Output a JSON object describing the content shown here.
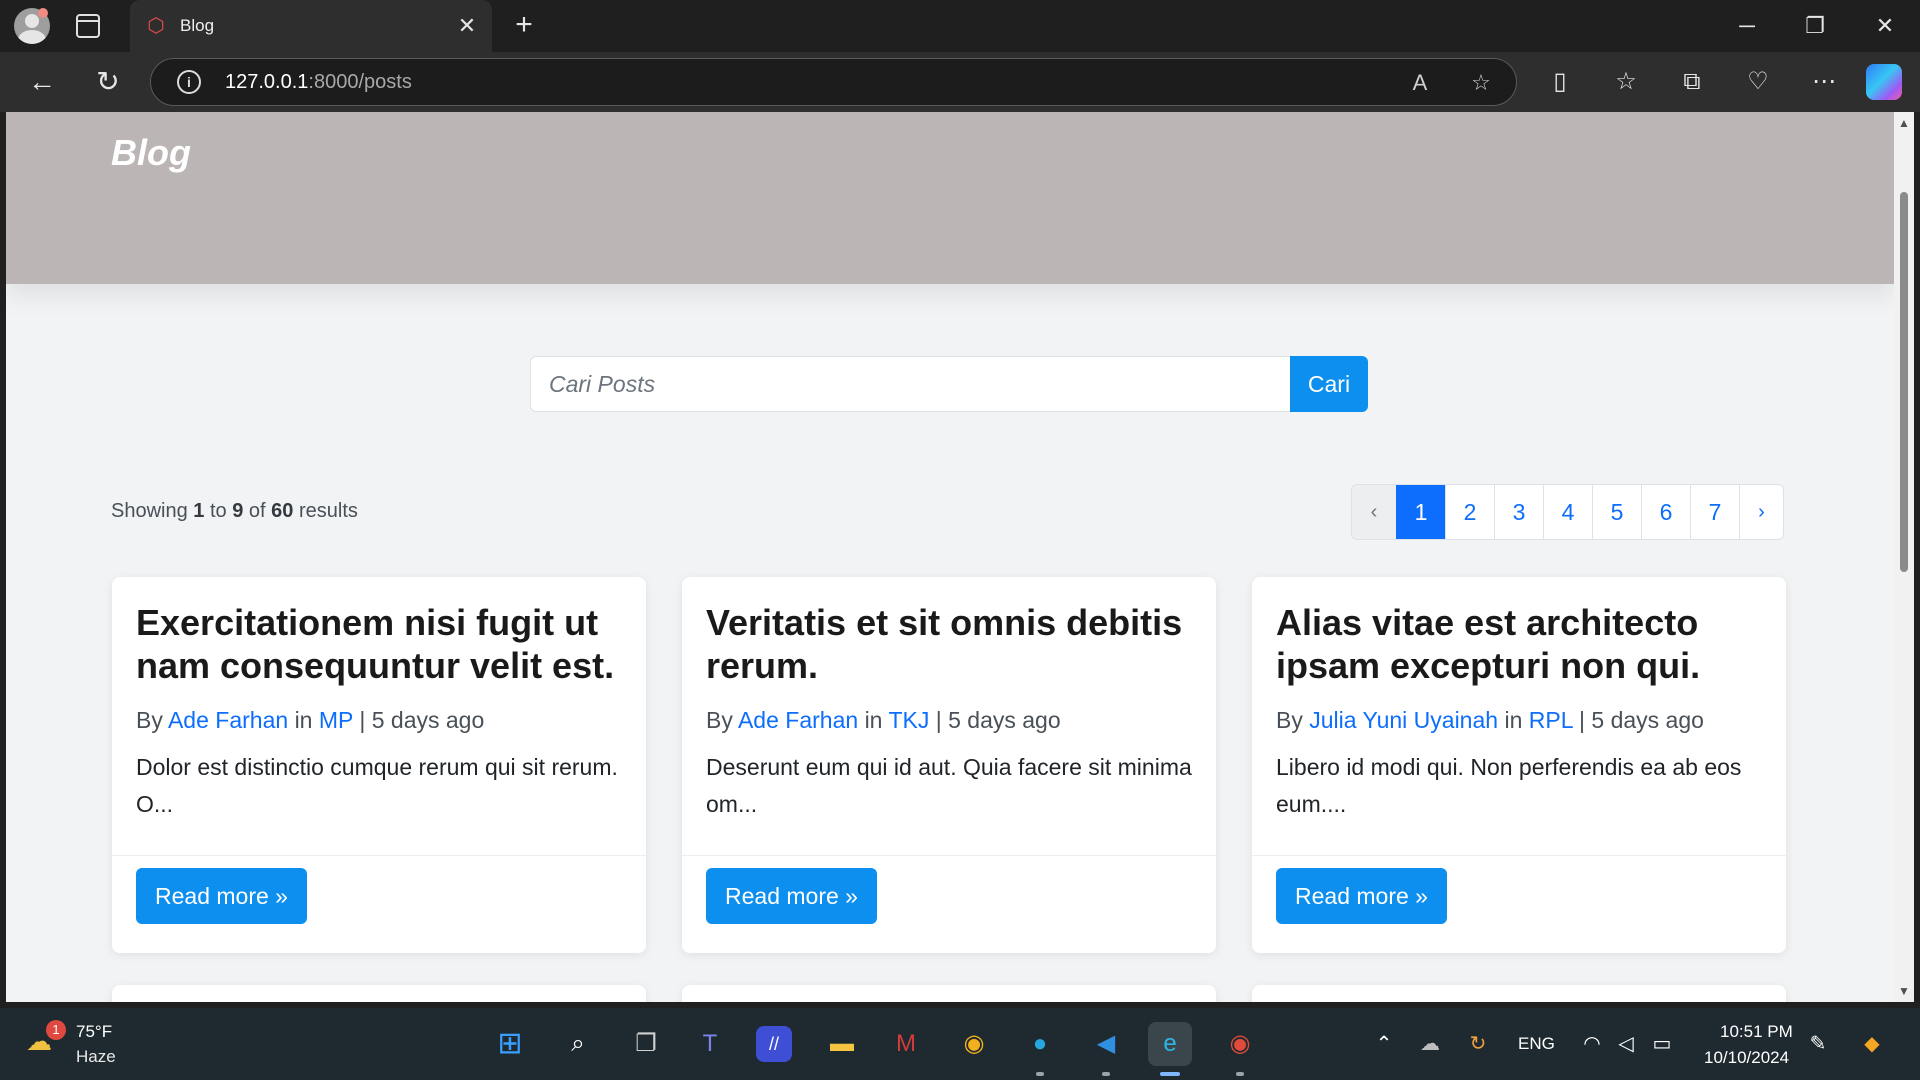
{
  "browser": {
    "tab_title": "Blog",
    "url_host": "127.0.0.1",
    "url_path": ":8000/posts"
  },
  "site": {
    "brand": "Blog",
    "search_placeholder": "Cari Posts",
    "search_button": "Cari",
    "results": {
      "prefix": "Showing",
      "from": "1",
      "to_word": "to",
      "to": "9",
      "of_word": "of",
      "total": "60",
      "suffix": "results"
    },
    "pagination": {
      "prev": "‹",
      "pages": [
        "1",
        "2",
        "3",
        "4",
        "5",
        "6",
        "7"
      ],
      "active": "1",
      "next": "›"
    }
  },
  "posts": [
    {
      "title": "Exercitationem nisi fugit ut nam consequuntur velit est.",
      "by": "By",
      "author": "Ade Farhan",
      "in": "in",
      "category": "MP",
      "sep": "|",
      "time": "5 days ago",
      "excerpt": "Dolor est distinctio cumque rerum qui sit rerum. O...",
      "button": "Read more »"
    },
    {
      "title": "Veritatis et sit omnis debitis rerum.",
      "by": "By",
      "author": "Ade Farhan",
      "in": "in",
      "category": "TKJ",
      "sep": "|",
      "time": "5 days ago",
      "excerpt": "Deserunt eum qui id aut. Quia facere sit minima om...",
      "button": "Read more »"
    },
    {
      "title": "Alias vitae est architecto ipsam excepturi non qui.",
      "by": "By",
      "author": "Julia Yuni Uyainah",
      "in": "in",
      "category": "RPL",
      "sep": "|",
      "time": "5 days ago",
      "excerpt": "Libero id modi qui. Non perferendis ea ab eos eum....",
      "button": "Read more »"
    }
  ],
  "taskbar": {
    "weather_badge": "1",
    "temp": "75°F",
    "condition": "Haze",
    "lang": "ENG",
    "time": "10:51 PM",
    "date": "10/10/2024"
  }
}
